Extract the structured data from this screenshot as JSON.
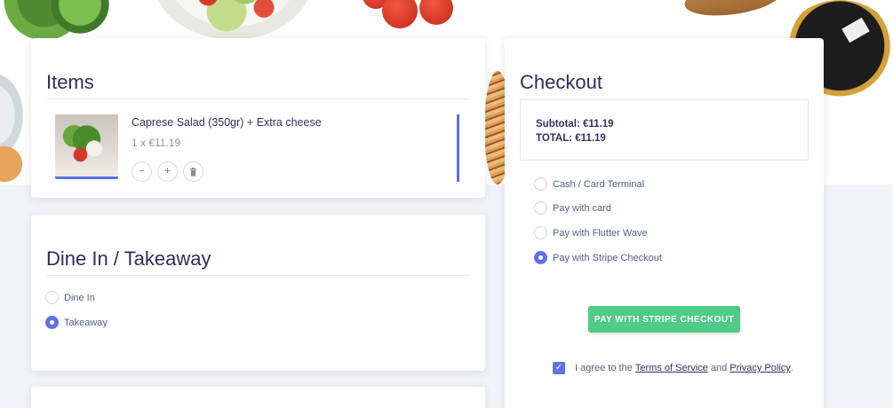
{
  "items_section": {
    "title": "Items",
    "items": [
      {
        "name": "Caprese Salad (350gr) + Extra cheese",
        "quantity_price": "1 x €11.19"
      }
    ],
    "decrease_symbol": "−",
    "increase_symbol": "+",
    "delete_symbol": "🗑"
  },
  "dine_section": {
    "title": "Dine In / Takeaway",
    "options": [
      {
        "label": "Dine In",
        "selected": false
      },
      {
        "label": "Takeaway",
        "selected": true
      }
    ]
  },
  "checkout": {
    "title": "Checkout",
    "subtotal": "Subtotal: €11.19",
    "total": "TOTAL: €11.19",
    "payment_methods": [
      {
        "label": "Cash / Card Terminal",
        "selected": false
      },
      {
        "label": "Pay with card",
        "selected": false
      },
      {
        "label": "Pay with Flutter Wave",
        "selected": false
      },
      {
        "label": "Pay with Stripe Checkout",
        "selected": true
      }
    ],
    "pay_button": "PAY WITH STRIPE CHECKOUT",
    "agree_prefix": "I agree to the",
    "terms_link": "Terms of Service",
    "agree_and": "and",
    "privacy_link": "Privacy Policy",
    "agree_suffix": ".",
    "agreed": true
  },
  "colors": {
    "accent": "#5e72e4",
    "pay_button": "#4fca87",
    "heading": "#2d2d5f"
  }
}
